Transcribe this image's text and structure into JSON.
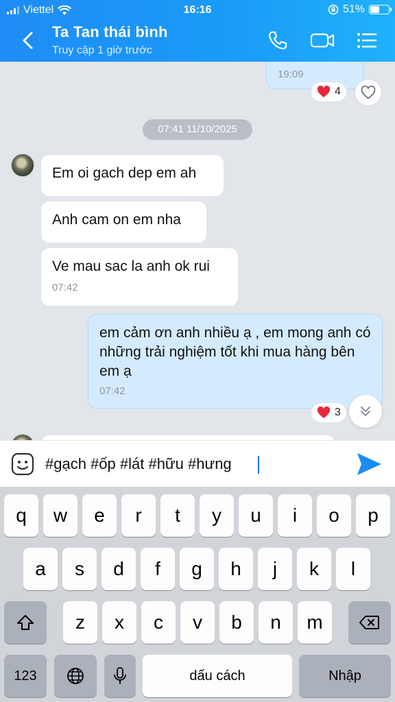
{
  "status_bar": {
    "carrier": "Viettel",
    "time": "16:16",
    "battery": "51%",
    "battery_level": 0.51
  },
  "header": {
    "title": "Ta Tan thái bình",
    "subtitle": "Truy cập 1 giờ trước"
  },
  "chat": {
    "prev_time": "19:09",
    "prev_reaction_count": "4",
    "date_separator": "07:41 11/10/2025",
    "incoming": [
      {
        "text": "Em oi gach dep em ah"
      },
      {
        "text": "Anh cam on em nha"
      },
      {
        "text": "Ve mau sac la anh ok rui",
        "time": "07:42"
      }
    ],
    "outgoing": {
      "text": "em cảm ơn anh nhiều ạ , em mong anh có những trải nghiệm tốt khi mua hàng bên em ạ",
      "time": "07:42",
      "reaction_count": "3"
    }
  },
  "composer": {
    "value": "#gạch #ốp #lát #hữu #hưng"
  },
  "keyboard": {
    "row1": [
      "q",
      "w",
      "e",
      "r",
      "t",
      "y",
      "u",
      "i",
      "o",
      "p"
    ],
    "row2": [
      "a",
      "s",
      "d",
      "f",
      "g",
      "h",
      "j",
      "k",
      "l"
    ],
    "row3": [
      "z",
      "x",
      "c",
      "v",
      "b",
      "n",
      "m"
    ],
    "numbers_label": "123",
    "space_label": "dấu cách",
    "return_label": "Nhập"
  },
  "colors": {
    "header_blue": "#1a9af7",
    "send_blue": "#1a8df2",
    "outgoing_bubble": "#d4ebfe",
    "heart_red": "#e8263c"
  },
  "icons": [
    "back-icon",
    "phone-icon",
    "video-call-icon",
    "menu-list-icon",
    "heart-icon",
    "chevron-double-down-icon",
    "sticker-icon",
    "send-icon",
    "shift-icon",
    "backspace-icon",
    "globe-icon",
    "mic-icon",
    "wifi-icon",
    "signal-icon",
    "battery-icon",
    "lock-rotation-icon"
  ]
}
